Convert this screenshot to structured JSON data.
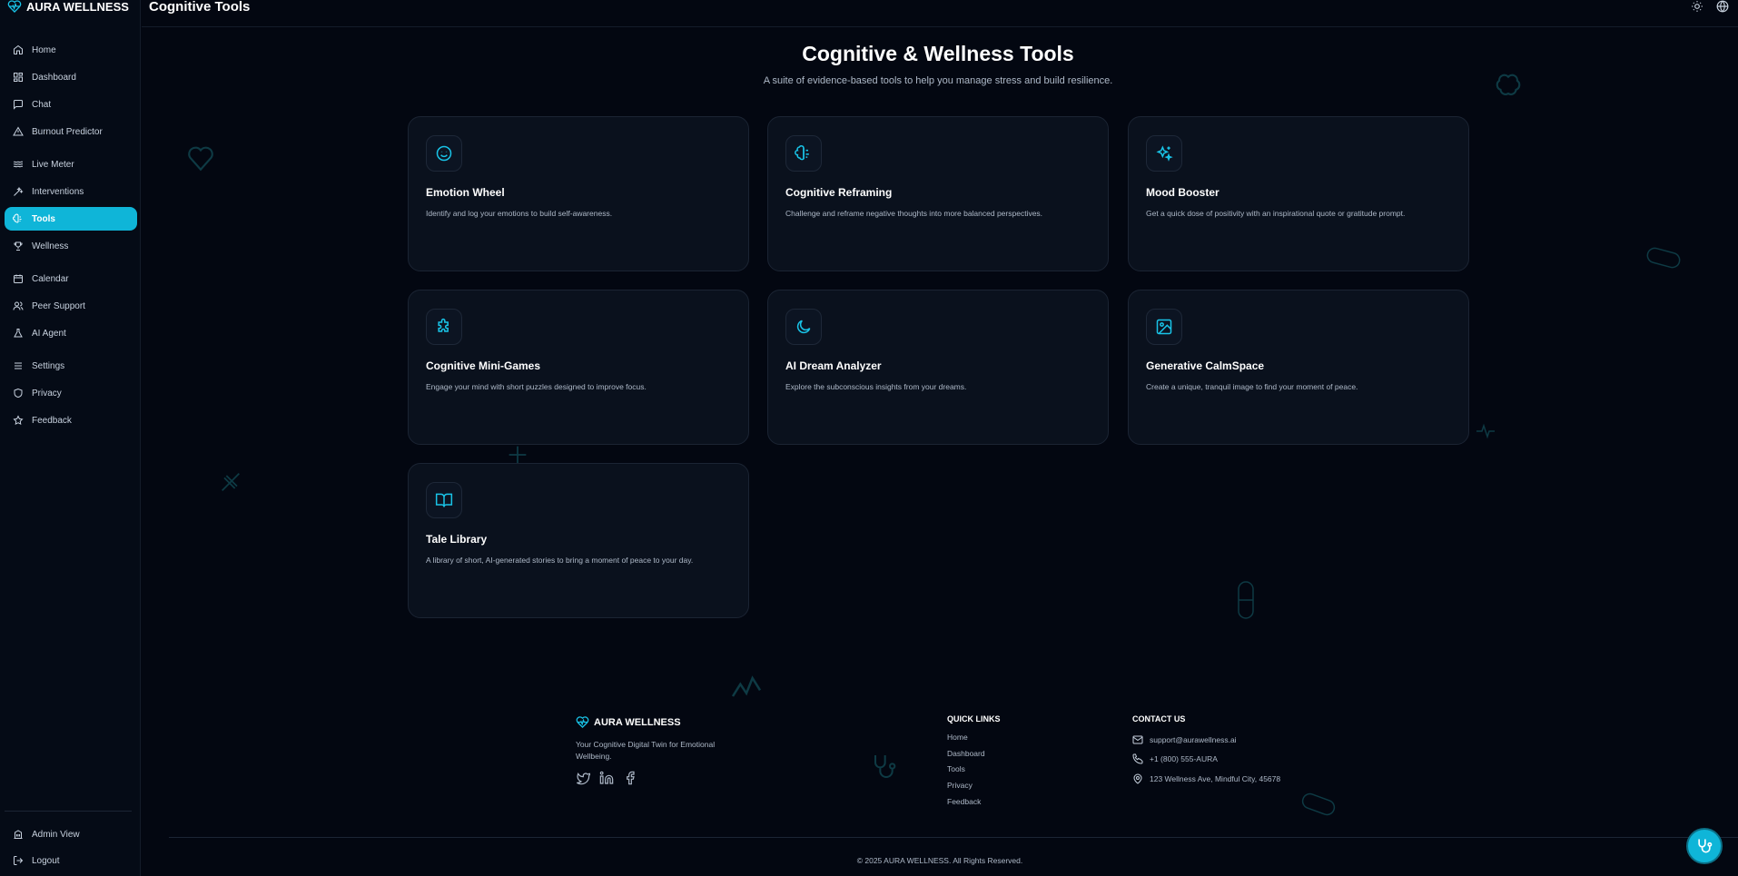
{
  "brand": {
    "name": "AURA WELLNESS",
    "icon": "heart-pulse-icon",
    "accent": "#0fb5d8"
  },
  "header": {
    "title": "Cognitive Tools",
    "theme_icon": "sun-icon",
    "language_icon": "globe-icon"
  },
  "sidebar": {
    "items": [
      {
        "label": "Home",
        "icon": "home-icon"
      },
      {
        "label": "Dashboard",
        "icon": "grid-icon"
      },
      {
        "label": "Chat",
        "icon": "chat-icon"
      },
      {
        "label": "Burnout Predictor",
        "icon": "warning-icon"
      },
      {
        "label": "Live Meter",
        "icon": "waves-icon"
      },
      {
        "label": "Interventions",
        "icon": "sparkles-icon"
      },
      {
        "label": "Tools",
        "icon": "brain-icon",
        "active": true
      },
      {
        "label": "Wellness",
        "icon": "trophy-icon"
      },
      {
        "label": "Calendar",
        "icon": "calendar-icon"
      },
      {
        "label": "Peer Support",
        "icon": "users-icon"
      },
      {
        "label": "AI Agent",
        "icon": "flask-icon"
      },
      {
        "label": "Settings",
        "icon": "sliders-icon"
      },
      {
        "label": "Privacy",
        "icon": "shield-icon"
      },
      {
        "label": "Feedback",
        "icon": "star-icon"
      }
    ],
    "bottom": [
      {
        "label": "Admin View",
        "icon": "building-icon"
      },
      {
        "label": "Logout",
        "icon": "logout-icon"
      }
    ]
  },
  "main": {
    "title": "Cognitive & Wellness Tools",
    "subtitle": "A suite of evidence-based tools to help you manage stress and build resilience.",
    "tools": [
      {
        "title": "Emotion Wheel",
        "desc": "Identify and log your emotions to build self-awareness.",
        "icon": "smile-icon"
      },
      {
        "title": "Cognitive Reframing",
        "desc": "Challenge and reframe negative thoughts into more balanced perspectives.",
        "icon": "brain-icon"
      },
      {
        "title": "Mood Booster",
        "desc": "Get a quick dose of positivity with an inspirational quote or gratitude prompt.",
        "icon": "sparkles-icon"
      },
      {
        "title": "Cognitive Mini-Games",
        "desc": "Engage your mind with short puzzles designed to improve focus.",
        "icon": "puzzle-icon"
      },
      {
        "title": "AI Dream Analyzer",
        "desc": "Explore the subconscious insights from your dreams.",
        "icon": "moon-icon"
      },
      {
        "title": "Generative CalmSpace",
        "desc": "Create a unique, tranquil image to find your moment of peace.",
        "icon": "image-icon"
      },
      {
        "title": "Tale Library",
        "desc": "A library of short, AI-generated stories to bring a moment of peace to your day.",
        "icon": "book-icon"
      }
    ]
  },
  "footer": {
    "brand": "AURA WELLNESS",
    "tagline": "Your Cognitive Digital Twin for Emotional Wellbeing.",
    "social": [
      "twitter-icon",
      "linkedin-icon",
      "facebook-icon"
    ],
    "quick_links_title": "QUICK LINKS",
    "quick_links": [
      "Home",
      "Dashboard",
      "Tools",
      "Privacy",
      "Feedback"
    ],
    "contact_title": "CONTACT US",
    "contact": {
      "email": "support@aurawellness.ai",
      "phone": "+1 (800) 555-AURA",
      "address": "123 Wellness Ave, Mindful City, 45678"
    },
    "copyright": "© 2025 AURA WELLNESS. All Rights Reserved."
  },
  "fab": {
    "icon": "stethoscope-icon"
  }
}
